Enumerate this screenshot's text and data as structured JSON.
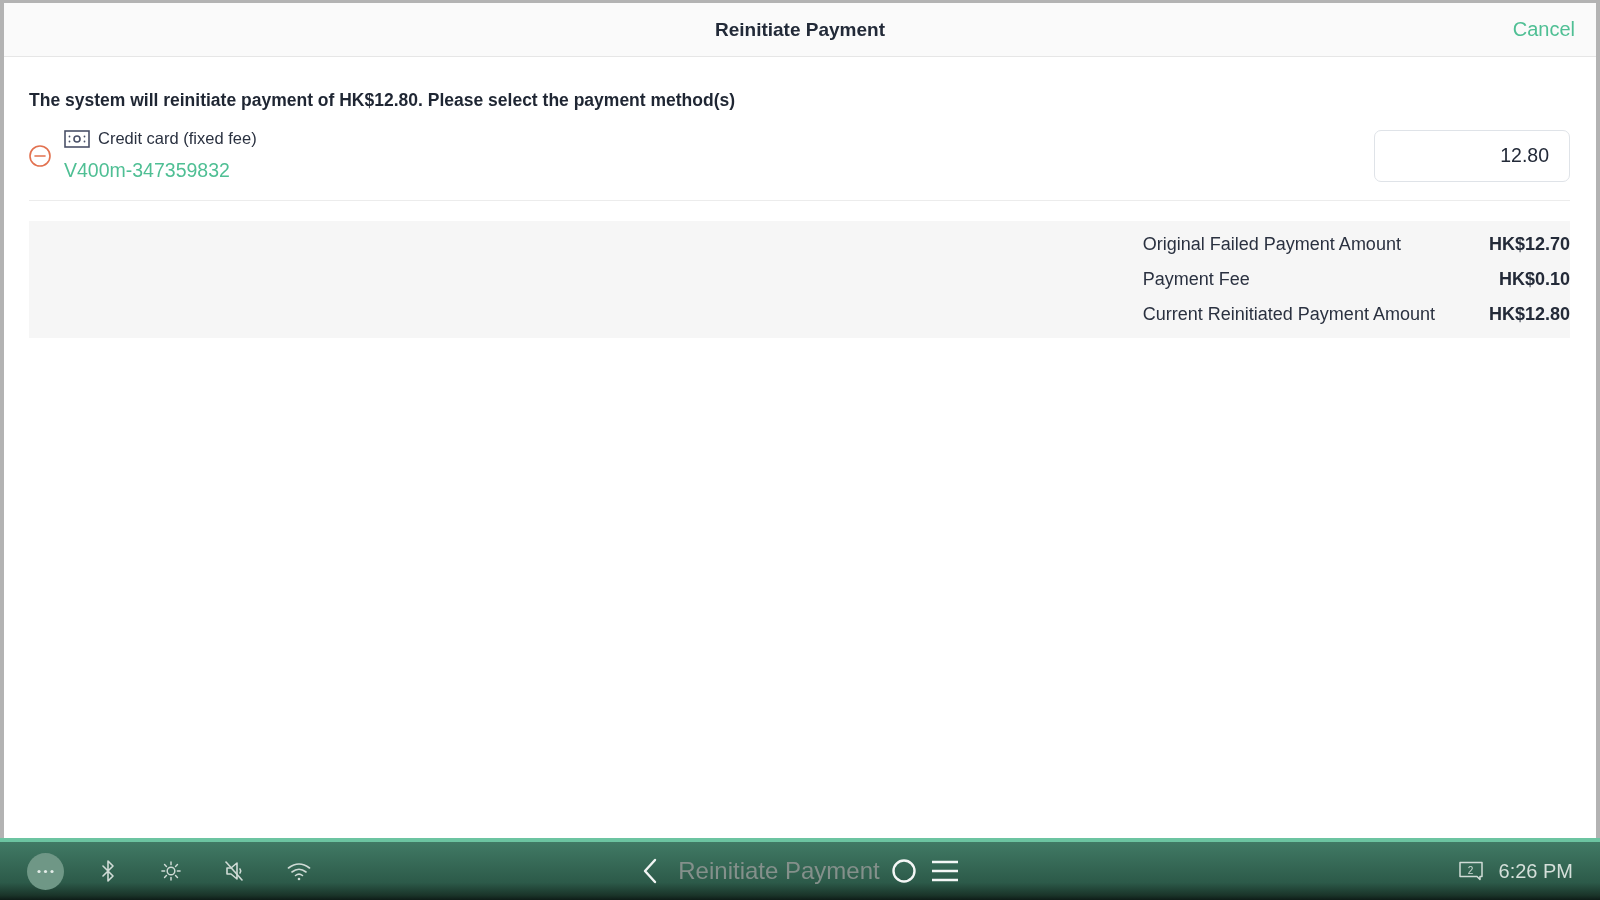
{
  "header": {
    "title": "Reinitiate Payment",
    "cancel": "Cancel"
  },
  "instruction": "The system will reinitiate payment of HK$12.80. Please select the payment method(s)",
  "payment_methods": [
    {
      "name": "Credit card (fixed fee)",
      "terminal": "V400m-347359832",
      "amount": "12.80"
    }
  ],
  "summary": [
    {
      "label": "Original Failed Payment Amount",
      "value": "HK$12.70"
    },
    {
      "label": "Payment Fee",
      "value": "HK$0.10"
    },
    {
      "label": "Current Reinitiated Payment Amount",
      "value": "HK$12.80"
    }
  ],
  "nav_bar": {
    "sound_muted": true,
    "app_title": "Reinitiate Payment",
    "window_count": "2",
    "time": "6:26 PM"
  }
}
